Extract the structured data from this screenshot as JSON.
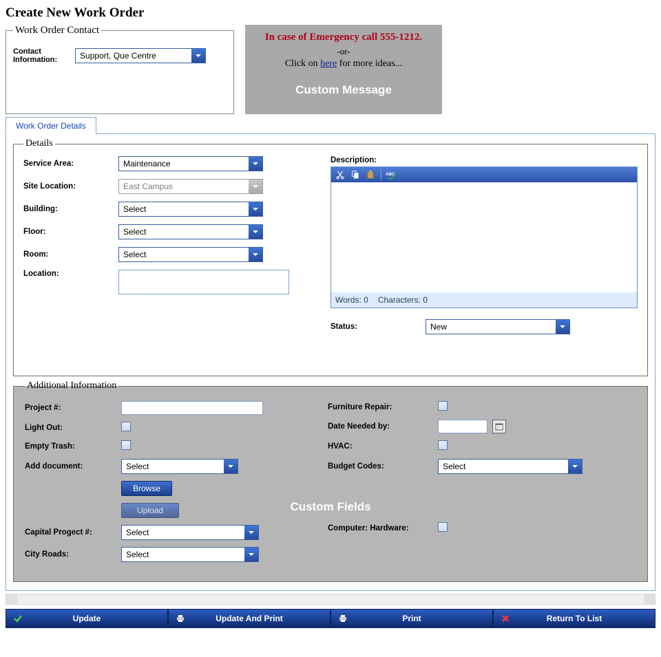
{
  "page": {
    "title": "Create New Work Order"
  },
  "contact": {
    "legend": "Work Order Contact",
    "label": "Contact Information:",
    "value": "Support, Que Centre"
  },
  "message": {
    "line1": "In case of Emergency call 555-1212.",
    "line2": "-or-",
    "line3a": "Click on ",
    "link": "here",
    "line3b": " for more ideas...",
    "caption": "Custom Message"
  },
  "tabs": {
    "details": "Work Order Details"
  },
  "details": {
    "legend": "Details",
    "labels": {
      "service_area": "Service Area:",
      "site_location": "Site Location:",
      "building": "Building:",
      "floor": "Floor:",
      "room": "Room:",
      "location": "Location:",
      "description": "Description:",
      "status": "Status:"
    },
    "values": {
      "service_area": "Maintenance",
      "site_location": "East Campus",
      "building": "Select",
      "floor": "Select",
      "room": "Select",
      "status": "New"
    },
    "counter": {
      "words_label": "Words:",
      "words": "0",
      "chars_label": "Characters:",
      "chars": "0"
    }
  },
  "additional": {
    "legend": "Additional Information",
    "caption": "Custom Fields",
    "labels": {
      "project": "Project #:",
      "light_out": "Light Out:",
      "empty_trash": "Empty Trash:",
      "add_document": "Add document:",
      "browse": "Browse",
      "upload": "Upload",
      "capital_project": "Capital Progect #:",
      "city_roads": "City Roads:",
      "furniture": "Furniture Repair:",
      "date_needed": "Date Needed by:",
      "hvac": "HVAC:",
      "budget_codes": "Budget Codes:",
      "computer_hw": "Computer: Hardware:"
    },
    "values": {
      "add_document": "Select",
      "capital_project": "Select",
      "city_roads": "Select",
      "budget_codes": "Select"
    }
  },
  "buttons": {
    "update": "Update",
    "update_print": "Update And Print",
    "print": "Print",
    "return": "Return To List"
  }
}
